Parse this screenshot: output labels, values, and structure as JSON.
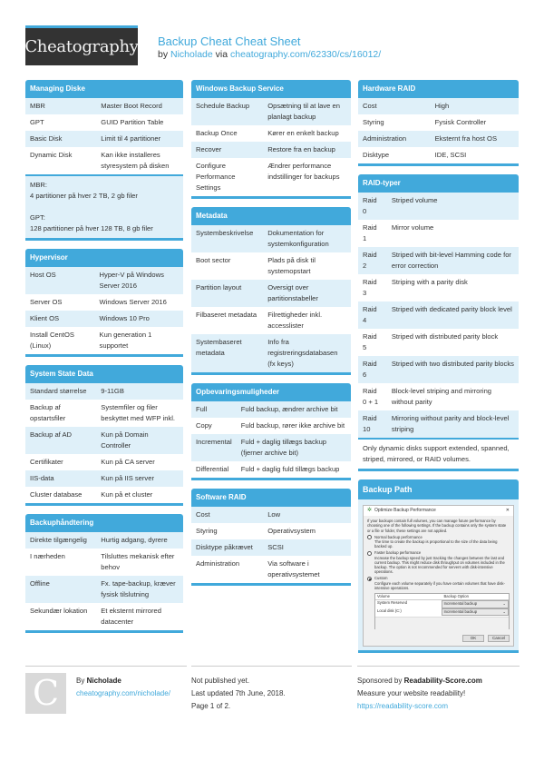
{
  "header": {
    "logo": "Cheatography",
    "title": "Backup Cheat Cheat Sheet",
    "by_prefix": "by",
    "author": "Nicholade",
    "via": "via",
    "url": "cheatography.com/62330/cs/16012/"
  },
  "colors": {
    "accent": "#41a9db",
    "row_alt": "#dff0f9",
    "logo_bg": "#333333"
  },
  "managing_diske": {
    "title": "Managing Diske",
    "rows": [
      [
        "MBR",
        "Master Boot Record"
      ],
      [
        "GPT",
        "GUID Partition Table"
      ],
      [
        "Basic Disk",
        "Limit til 4 partitioner"
      ],
      [
        "Dynamic Disk",
        "Kan ikke installeres styresystem på disken"
      ]
    ],
    "note": [
      "MBR:",
      "4 partitioner på hver 2 TB, 2 gb filer",
      "",
      "GPT:",
      "128 partitioner på hver 128 TB, 8 gb filer"
    ]
  },
  "hypervisor": {
    "title": "Hypervisor",
    "rows": [
      [
        "Host OS",
        "Hyper-V på Windows Server 2016"
      ],
      [
        "Server OS",
        "Windows Server 2016"
      ],
      [
        "Klient OS",
        "Windows 10 Pro"
      ],
      [
        "Install CentOS (Linux)",
        "Kun generation 1 supportet"
      ]
    ]
  },
  "system_state": {
    "title": "System State Data",
    "rows": [
      [
        "Standard størrelse",
        "9-11GB"
      ],
      [
        "Backup af opstartsfiler",
        "Systemfiler og filer beskyttet med WFP inkl."
      ],
      [
        "Backup af AD",
        "Kun på Domain Controller"
      ],
      [
        "Certifikater",
        "Kun på CA server"
      ],
      [
        "IIS-data",
        "Kun på IIS server"
      ],
      [
        "Cluster database",
        "Kun på et cluster"
      ]
    ]
  },
  "backuphaandtering": {
    "title": "Backuphåndtering",
    "rows": [
      [
        "Direkte tilgængelig",
        "Hurtig adgang, dyrere"
      ],
      [
        "I nærheden",
        "Tilsluttes mekanisk efter behov"
      ],
      [
        "Offline",
        "Fx. tape-backup, kræver fysisk tilslutning"
      ],
      [
        "Sekundær lokation",
        "Et eksternt mirrored datacenter"
      ]
    ]
  },
  "windows_backup": {
    "title": "Windows Backup Service",
    "rows": [
      [
        "Schedule Backup",
        "Opsætning til at lave en planlagt backup"
      ],
      [
        "Backup Once",
        "Kører en enkelt backup"
      ],
      [
        "Recover",
        "Restore fra en backup"
      ],
      [
        "Configure Performance Settings",
        "Ændrer performance indstillinger for backups"
      ]
    ]
  },
  "metadata": {
    "title": "Metadata",
    "rows": [
      [
        "Systembeskrivelse",
        "Dokumentation for systemkonfiguration"
      ],
      [
        "Boot sector",
        "Plads på disk til systemopstart"
      ],
      [
        "Partition layout",
        "Oversigt over partitionstabeller"
      ],
      [
        "Filbaseret metadata",
        "Filrettigheder inkl. accesslister"
      ],
      [
        "Systembaseret metadata",
        "Info fra registreringsdatabasen (fx keys)"
      ]
    ]
  },
  "opbevaring": {
    "title": "Opbevaringsmuligheder",
    "rows": [
      [
        "Full",
        "Fuld backup, ændrer archive bit"
      ],
      [
        "Copy",
        "Fuld backup, rører ikke archive bit"
      ],
      [
        "Incremental",
        "Fuld + daglig tillægs backup (fjerner archive bit)"
      ],
      [
        "Differential",
        "Fuld + daglig fuld tillægs backup"
      ]
    ]
  },
  "software_raid": {
    "title": "Software RAID",
    "rows": [
      [
        "Cost",
        "Low"
      ],
      [
        "Styring",
        "Operativsystem"
      ],
      [
        "Disktype påkrævet",
        "SCSI"
      ],
      [
        "Administration",
        "Via software i operativsystemet"
      ]
    ]
  },
  "hardware_raid": {
    "title": "Hardware RAID",
    "rows": [
      [
        "Cost",
        "High"
      ],
      [
        "Styring",
        "Fysisk Controller"
      ],
      [
        "Administration",
        "Eksternt fra host OS"
      ],
      [
        "Disktype",
        "IDE, SCSI"
      ]
    ]
  },
  "raid_typer": {
    "title": "RAID-typer",
    "rows": [
      [
        "Raid 0",
        "Striped volume"
      ],
      [
        "Raid 1",
        "Mirror volume"
      ],
      [
        "Raid 2",
        "Striped with bit-level Hamming code for error correction"
      ],
      [
        "Raid 3",
        "Striping with a parity disk"
      ],
      [
        "Raid 4",
        "Striped with dedicated parity block level"
      ],
      [
        "Raid 5",
        "Striped with distributed parity block"
      ],
      [
        "Raid 6",
        "Striped with two distributed parity blocks"
      ],
      [
        "Raid 0 + 1",
        "Block-level striping and mirroring without parity"
      ],
      [
        "Raid 10",
        "Mirroring without parity and block-level striping"
      ]
    ],
    "note": "Only dynamic disks support extended, spanned, striped, mirrored, or RAID volumes."
  },
  "backup_path": {
    "title": "Backup Path",
    "dialog": {
      "title": "Optimize Backup Performance",
      "intro": "If your backups contain full volumes, you can manage future performance by choosing one of the following settings. If the backup contains only the system state or a file or folder, these settings are not applied.",
      "options": [
        {
          "label": "Normal backup performance",
          "desc": "The time to create the backup is proportional to the size of the data being backed up.",
          "selected": false
        },
        {
          "label": "Faster backup performance",
          "desc": "Increase the backup speed by just tracking the changes between the last and current backup. This might reduce disk throughput on volumes included in the backup. The option is not recommended for servers with disk-intensive operations.",
          "selected": false
        },
        {
          "label": "Custom",
          "desc": "Configure each volume separately if you have certain volumes that have disk-intensive operations.",
          "selected": true
        }
      ],
      "table_headers": [
        "Volume",
        "Backup Option"
      ],
      "table_rows": [
        [
          "System Reserved",
          "Incremental backup"
        ],
        [
          "Local disk (C:)",
          "Incremental backup"
        ]
      ],
      "ok": "OK",
      "cancel": "Cancel"
    }
  },
  "footer": {
    "by": "By",
    "author": "Nicholade",
    "author_url": "cheatography.com/nicholade/",
    "avatar_letter": "C",
    "published": "Not published yet.",
    "updated": "Last updated 7th June, 2018.",
    "page": "Page 1 of 2.",
    "sponsored_prefix": "Sponsored by",
    "sponsor": "Readability-Score.com",
    "sponsor_tagline": "Measure your website readability!",
    "sponsor_url": "https://readability-score.com"
  }
}
